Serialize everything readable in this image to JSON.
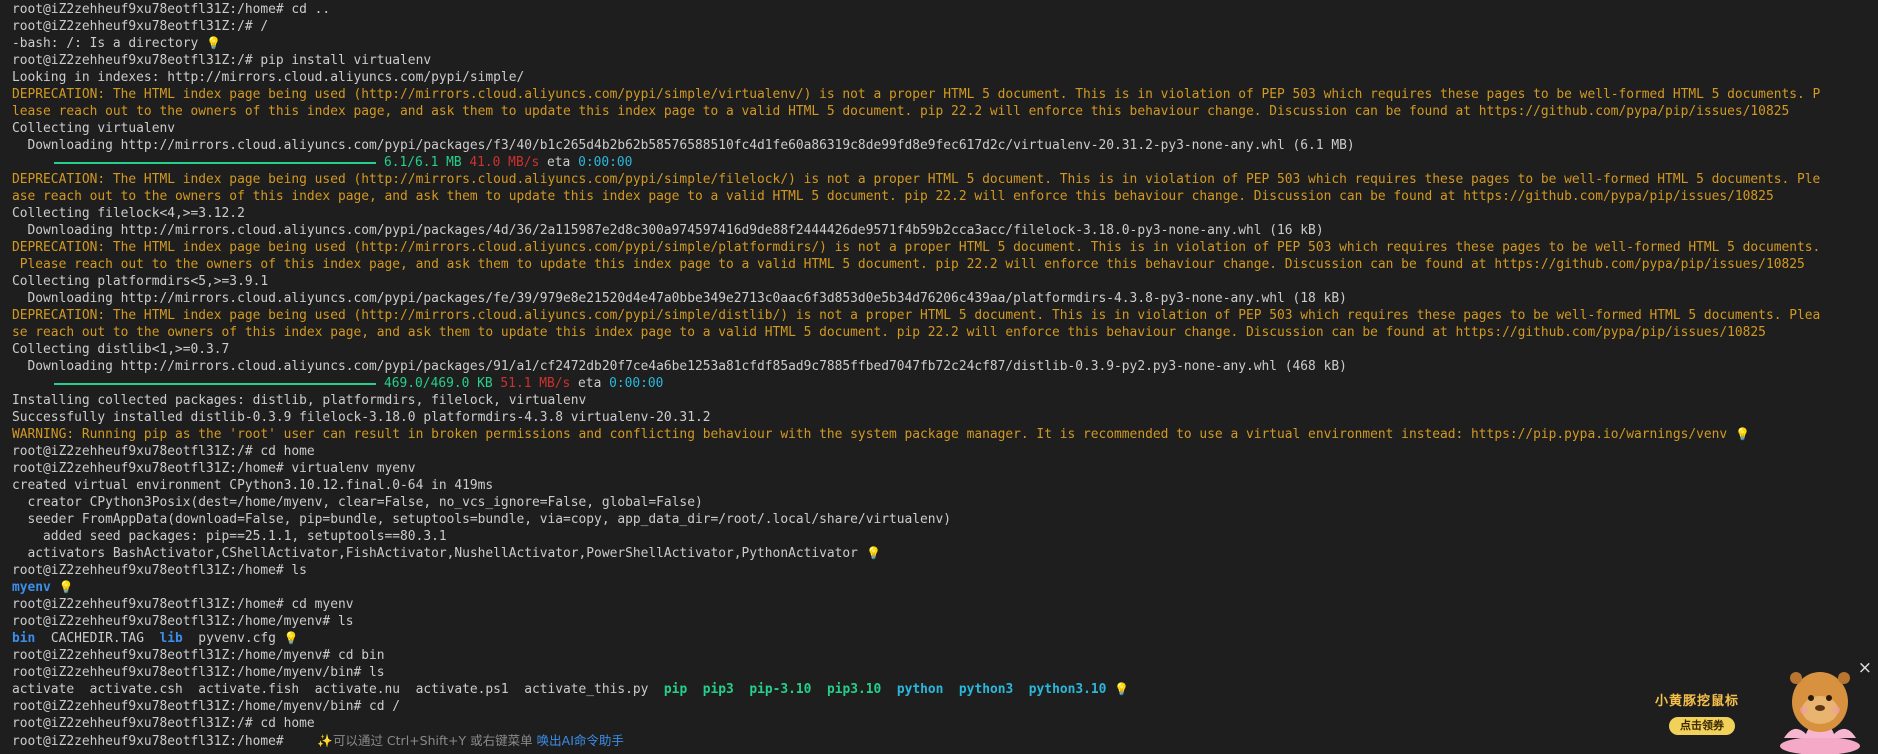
{
  "terminal": {
    "lines": [
      {
        "t": "root@iZ2zehheuf9xu78eotfl31Z:/home# cd ..",
        "c": "normal"
      },
      {
        "t": "root@iZ2zehheuf9xu78eotfl31Z:/# /",
        "c": "normal"
      },
      {
        "t": "-bash: /: Is a directory",
        "c": "normal",
        "bulb": true
      },
      {
        "t": "root@iZ2zehheuf9xu78eotfl31Z:/# pip install virtualenv",
        "c": "normal"
      },
      {
        "t": "Looking in indexes: http://mirrors.cloud.aliyuncs.com/pypi/simple/",
        "c": "normal"
      },
      {
        "t": "DEPRECATION: The HTML index page being used (http://mirrors.cloud.aliyuncs.com/pypi/simple/virtualenv/) is not a proper HTML 5 document. This is in violation of PEP 503 which requires these pages to be well-formed HTML 5 documents. P",
        "c": "warn"
      },
      {
        "t": "lease reach out to the owners of this index page, and ask them to update this index page to a valid HTML 5 document. pip 22.2 will enforce this behaviour change. Discussion can be found at https://github.com/pypa/pip/issues/10825",
        "c": "warn"
      },
      {
        "t": "Collecting virtualenv",
        "c": "normal"
      },
      {
        "t": "  Downloading http://mirrors.cloud.aliyuncs.com/pypi/packages/f3/40/b1c265d4b2b62b58576588510fc4d1fe60a86319c8de99fd8e9fec617d2c/virtualenv-20.31.2-py3-none-any.whl (6.1 MB)",
        "c": "normal"
      },
      {
        "progress": true,
        "size": "6.1/6.1 MB",
        "speed": "41.0 MB/s",
        "eta": "eta",
        "time": "0:00:00"
      },
      {
        "t": "DEPRECATION: The HTML index page being used (http://mirrors.cloud.aliyuncs.com/pypi/simple/filelock/) is not a proper HTML 5 document. This is in violation of PEP 503 which requires these pages to be well-formed HTML 5 documents. Ple",
        "c": "warn"
      },
      {
        "t": "ase reach out to the owners of this index page, and ask them to update this index page to a valid HTML 5 document. pip 22.2 will enforce this behaviour change. Discussion can be found at https://github.com/pypa/pip/issues/10825",
        "c": "warn"
      },
      {
        "t": "Collecting filelock<4,>=3.12.2",
        "c": "normal"
      },
      {
        "t": "  Downloading http://mirrors.cloud.aliyuncs.com/pypi/packages/4d/36/2a115987e2d8c300a974597416d9de88f2444426de9571f4b59b2cca3acc/filelock-3.18.0-py3-none-any.whl (16 kB)",
        "c": "normal"
      },
      {
        "t": "DEPRECATION: The HTML index page being used (http://mirrors.cloud.aliyuncs.com/pypi/simple/platformdirs/) is not a proper HTML 5 document. This is in violation of PEP 503 which requires these pages to be well-formed HTML 5 documents.",
        "c": "warn"
      },
      {
        "t": " Please reach out to the owners of this index page, and ask them to update this index page to a valid HTML 5 document. pip 22.2 will enforce this behaviour change. Discussion can be found at https://github.com/pypa/pip/issues/10825",
        "c": "warn"
      },
      {
        "t": "Collecting platformdirs<5,>=3.9.1",
        "c": "normal"
      },
      {
        "t": "  Downloading http://mirrors.cloud.aliyuncs.com/pypi/packages/fe/39/979e8e21520d4e47a0bbe349e2713c0aac6f3d853d0e5b34d76206c439aa/platformdirs-4.3.8-py3-none-any.whl (18 kB)",
        "c": "normal"
      },
      {
        "t": "DEPRECATION: The HTML index page being used (http://mirrors.cloud.aliyuncs.com/pypi/simple/distlib/) is not a proper HTML 5 document. This is in violation of PEP 503 which requires these pages to be well-formed HTML 5 documents. Plea",
        "c": "warn"
      },
      {
        "t": "se reach out to the owners of this index page, and ask them to update this index page to a valid HTML 5 document. pip 22.2 will enforce this behaviour change. Discussion can be found at https://github.com/pypa/pip/issues/10825",
        "c": "warn"
      },
      {
        "t": "Collecting distlib<1,>=0.3.7",
        "c": "normal"
      },
      {
        "t": "  Downloading http://mirrors.cloud.aliyuncs.com/pypi/packages/91/a1/cf2472db20f7ce4a6be1253a81cfdf85ad9c7885ffbed7047fb72c24cf87/distlib-0.3.9-py2.py3-none-any.whl (468 kB)",
        "c": "normal"
      },
      {
        "progress": true,
        "size": "469.0/469.0 KB",
        "speed": "51.1 MB/s",
        "eta": "eta",
        "time": "0:00:00"
      },
      {
        "t": "Installing collected packages: distlib, platformdirs, filelock, virtualenv",
        "c": "normal"
      },
      {
        "t": "Successfully installed distlib-0.3.9 filelock-3.18.0 platformdirs-4.3.8 virtualenv-20.31.2",
        "c": "normal"
      },
      {
        "t": "WARNING: Running pip as the 'root' user can result in broken permissions and conflicting behaviour with the system package manager. It is recommended to use a virtual environment instead: https://pip.pypa.io/warnings/venv",
        "c": "warn",
        "bulb": true
      },
      {
        "t": "root@iZ2zehheuf9xu78eotfl31Z:/# cd home",
        "c": "normal"
      },
      {
        "t": "root@iZ2zehheuf9xu78eotfl31Z:/home# virtualenv myenv",
        "c": "normal"
      },
      {
        "t": "created virtual environment CPython3.10.12.final.0-64 in 419ms",
        "c": "normal"
      },
      {
        "t": "  creator CPython3Posix(dest=/home/myenv, clear=False, no_vcs_ignore=False, global=False)",
        "c": "normal"
      },
      {
        "t": "  seeder FromAppData(download=False, pip=bundle, setuptools=bundle, via=copy, app_data_dir=/root/.local/share/virtualenv)",
        "c": "normal"
      },
      {
        "t": "    added seed packages: pip==25.1.1, setuptools==80.3.1",
        "c": "normal"
      },
      {
        "t": "  activators BashActivator,CShellActivator,FishActivator,NushellActivator,PowerShellActivator,PythonActivator",
        "c": "normal",
        "bulb": true
      },
      {
        "t": "root@iZ2zehheuf9xu78eotfl31Z:/home# ls",
        "c": "normal"
      },
      {
        "segs": [
          {
            "t": "myenv",
            "c": "dir"
          }
        ],
        "bulb": true
      },
      {
        "t": "root@iZ2zehheuf9xu78eotfl31Z:/home# cd myenv",
        "c": "normal"
      },
      {
        "t": "root@iZ2zehheuf9xu78eotfl31Z:/home/myenv# ls",
        "c": "normal"
      },
      {
        "segs": [
          {
            "t": "bin",
            "c": "dir"
          },
          {
            "t": "  CACHEDIR.TAG  ",
            "c": "normal"
          },
          {
            "t": "lib",
            "c": "dir"
          },
          {
            "t": "  pyvenv.cfg",
            "c": "normal"
          }
        ],
        "bulb": true
      },
      {
        "t": "root@iZ2zehheuf9xu78eotfl31Z:/home/myenv# cd bin",
        "c": "normal"
      },
      {
        "t": "root@iZ2zehheuf9xu78eotfl31Z:/home/myenv/bin# ls",
        "c": "normal"
      },
      {
        "segs": [
          {
            "t": "activate  activate.csh  activate.fish  activate.nu  activate.ps1  activate_this.py  ",
            "c": "normal"
          },
          {
            "t": "pip",
            "c": "exec"
          },
          {
            "t": "  ",
            "c": "normal"
          },
          {
            "t": "pip3",
            "c": "exec"
          },
          {
            "t": "  ",
            "c": "normal"
          },
          {
            "t": "pip-3.10",
            "c": "exec"
          },
          {
            "t": "  ",
            "c": "normal"
          },
          {
            "t": "pip3.10",
            "c": "exec"
          },
          {
            "t": "  ",
            "c": "normal"
          },
          {
            "t": "python",
            "c": "link"
          },
          {
            "t": "  ",
            "c": "normal"
          },
          {
            "t": "python3",
            "c": "link"
          },
          {
            "t": "  ",
            "c": "normal"
          },
          {
            "t": "python3.10",
            "c": "link"
          }
        ],
        "bulb": true
      },
      {
        "t": "root@iZ2zehheuf9xu78eotfl31Z:/home/myenv/bin# cd /",
        "c": "normal"
      },
      {
        "t": "root@iZ2zehheuf9xu78eotfl31Z:/# cd home",
        "c": "normal"
      },
      {
        "t": "root@iZ2zehheuf9xu78eotfl31Z:/home# ",
        "c": "normal",
        "hint": true
      }
    ],
    "hint_text": "✨可以通过 Ctrl+Shift+Y 或右键菜单",
    "hint_link": "唤出AI命令助手",
    "bulb_glyph": "💡"
  },
  "promo": {
    "title": "小黄豚挖鼠标",
    "button": "点击领券",
    "close": "×"
  },
  "colors": {
    "background": "#1e1e1e",
    "text": "#cccccc",
    "warning": "#d29922",
    "directory": "#3b8eea",
    "executable": "#23d18b",
    "symlink": "#29b8db",
    "progress": "#23d18b",
    "speed": "#cd3131"
  }
}
